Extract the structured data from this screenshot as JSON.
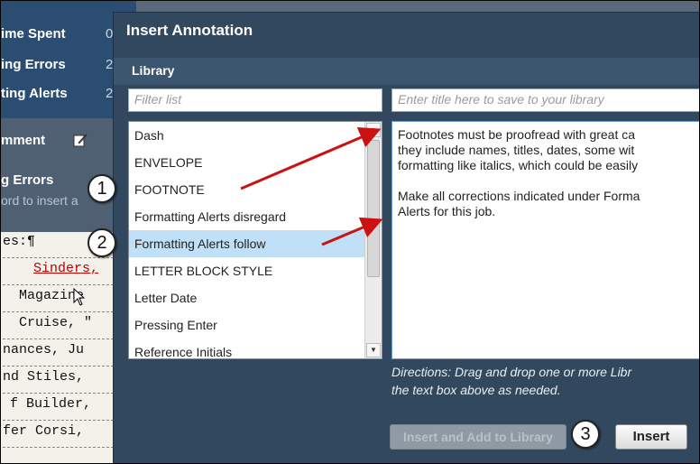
{
  "background": {
    "stats": [
      {
        "label": "ime Spent",
        "value": "0"
      },
      {
        "label": "ing Errors",
        "value": "2"
      },
      {
        "label": "ting Alerts",
        "value": "2"
      }
    ],
    "comment_label": "mment",
    "errors_label": "g Errors",
    "hint": "ord to insert a",
    "doc_lines": [
      "es:¶",
      "Sinders,",
      "Magazine",
      "Cruise, \"",
      "nances, Ju",
      "nd Stiles,",
      "f Builder,",
      "fer Corsi,"
    ]
  },
  "dialog": {
    "title": "Insert Annotation",
    "section": "Library",
    "filter_placeholder": "Filter list",
    "title_placeholder": "Enter title here to save to your library",
    "list_items": [
      "Dash",
      "ENVELOPE",
      "FOOTNOTE",
      "Formatting Alerts disregard",
      "Formatting Alerts follow",
      "LETTER BLOCK STYLE",
      "Letter Date",
      "Pressing Enter",
      "Reference Initials"
    ],
    "selected_index": 4,
    "annotation_text": "Footnotes must be proofread with great ca\nthey include names, titles, dates, some wit\nformatting like italics, which could be easily\n\nMake all corrections indicated under Forma\nAlerts for this job.",
    "directions_line1": "Directions: Drag and drop one or more Libr",
    "directions_line2": "the text box above as needed.",
    "insert_add_label": "Insert and Add to Library",
    "insert_label": "Insert"
  },
  "callouts": [
    "1",
    "2",
    "3"
  ],
  "colors": {
    "dialog_bg": "#32485f",
    "selected_row": "#bfe0f7",
    "arrow": "#cc1111"
  }
}
